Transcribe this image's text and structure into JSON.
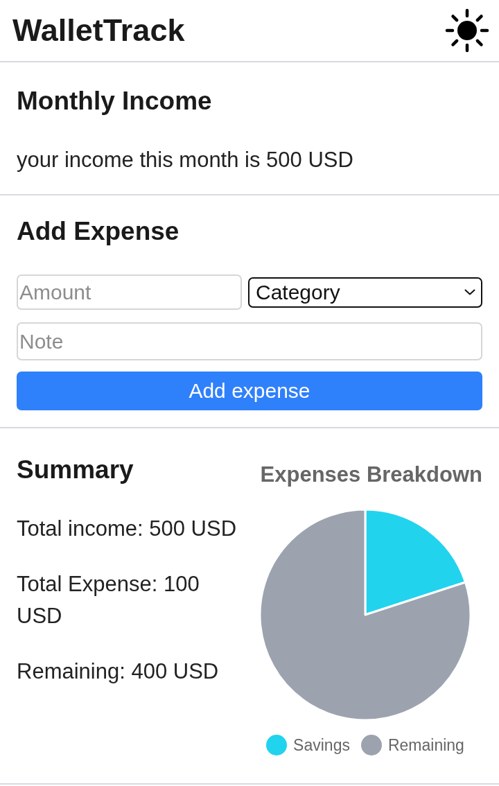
{
  "app": {
    "title": "WalletTrack"
  },
  "income": {
    "heading": "Monthly Income",
    "text": "your income this month is 500 USD"
  },
  "add_expense": {
    "heading": "Add Expense",
    "amount": {
      "placeholder": "Amount"
    },
    "category": {
      "value": "Category"
    },
    "note": {
      "placeholder": "Note"
    },
    "button": "Add expense"
  },
  "summary": {
    "heading": "Summary",
    "lines": [
      "Total income: 500 USD",
      "Total Expense: 100 USD",
      "Remaining: 400 USD"
    ],
    "chart": {
      "chart_data": {
        "type": "pie",
        "title": "Expenses Breakdown",
        "categories": [
          "Savings",
          "Remaining"
        ],
        "values": [
          20,
          80
        ]
      },
      "legend": [
        {
          "color": "#22d3ee"
        },
        {
          "color": "#9ca3af"
        }
      ]
    }
  }
}
